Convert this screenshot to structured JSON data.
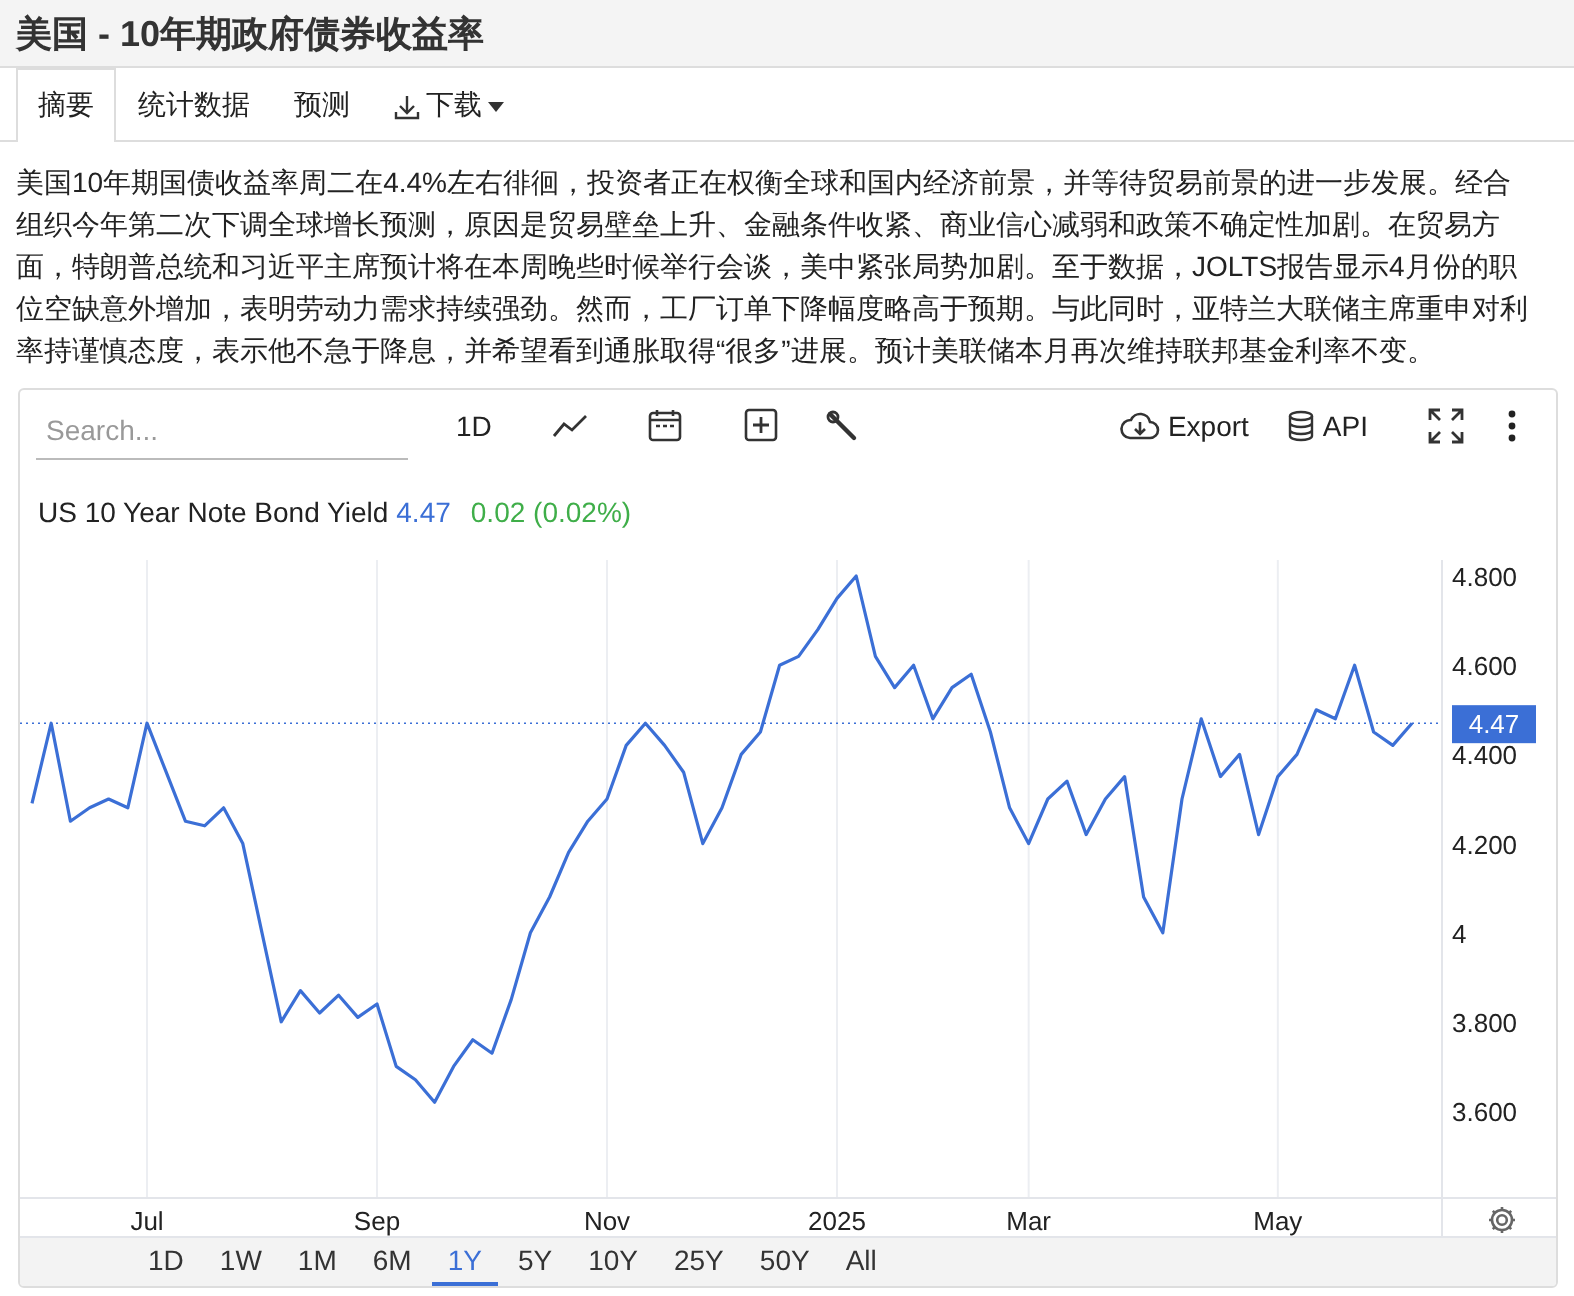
{
  "header": {
    "title": "美国 - 10年期政府债券收益率"
  },
  "tabs": [
    {
      "label": "摘要",
      "selected": true,
      "kind": "plain"
    },
    {
      "label": "统计数据",
      "selected": false,
      "kind": "plain"
    },
    {
      "label": "预测",
      "selected": false,
      "kind": "plain"
    },
    {
      "label": "下载",
      "selected": false,
      "kind": "download"
    }
  ],
  "summary": "美国10年期国债收益率周二在4.4%左右徘徊，投资者正在权衡全球和国内经济前景，并等待贸易前景的进一步发展。经合组织今年第二次下调全球增长预测，原因是贸易壁垒上升、金融条件收紧、商业信心减弱和政策不确定性加剧。在贸易方面，特朗普总统和习近平主席预计将在本周晚些时候举行会谈，美中紧张局势加剧。至于数据，JOLTS报告显示4月份的职位空缺意外增加，表明劳动力需求持续强劲。然而，工厂订单下降幅度略高于预期。与此同时，亚特兰大联储主席重申对利率持谨慎态度，表示他不急于降息，并希望看到通胀取得“很多”进展。预计美联储本月再次维持联邦基金利率不变。",
  "chart": {
    "search": {
      "placeholder": "Search..."
    },
    "interval": "1D",
    "export": "Export",
    "api": "API",
    "legend": {
      "value": "4.47",
      "change": "0.02 (0.02%)"
    },
    "last_label": "4.47",
    "chart_data": {
      "type": "line",
      "categories": [
        null,
        null,
        null,
        null,
        null,
        null,
        "Jul",
        null,
        null,
        null,
        null,
        null,
        null,
        null,
        null,
        null,
        null,
        null,
        "Sep",
        null,
        null,
        null,
        null,
        null,
        null,
        null,
        null,
        null,
        null,
        null,
        "Nov",
        null,
        null,
        null,
        null,
        null,
        null,
        null,
        null,
        null,
        null,
        null,
        "2025",
        null,
        null,
        null,
        null,
        null,
        null,
        null,
        null,
        null,
        "Mar",
        null,
        null,
        null,
        null,
        null,
        null,
        null,
        null,
        null,
        null,
        null,
        null,
        "May",
        null,
        null,
        null,
        null,
        null,
        null,
        null
      ],
      "series": [
        {
          "name": "US 10 Year Note Bond Yield",
          "color": "#3b6fd6",
          "values": [
            4.29,
            4.47,
            4.25,
            4.28,
            4.3,
            4.28,
            4.47,
            4.36,
            4.25,
            4.24,
            4.28,
            4.2,
            4.0,
            3.8,
            3.87,
            3.82,
            3.86,
            3.81,
            3.84,
            3.7,
            3.67,
            3.62,
            3.7,
            3.76,
            3.73,
            3.85,
            4.0,
            4.08,
            4.18,
            4.25,
            4.3,
            4.42,
            4.47,
            4.42,
            4.36,
            4.2,
            4.28,
            4.4,
            4.45,
            4.6,
            4.62,
            4.68,
            4.75,
            4.8,
            4.62,
            4.55,
            4.6,
            4.48,
            4.55,
            4.58,
            4.45,
            4.28,
            4.2,
            4.3,
            4.34,
            4.22,
            4.3,
            4.35,
            4.08,
            4.0,
            4.3,
            4.48,
            4.35,
            4.4,
            4.22,
            4.35,
            4.4,
            4.5,
            4.48,
            4.6,
            4.45,
            4.42,
            4.47
          ]
        }
      ],
      "ylim": [
        3.405,
        4.836
      ],
      "grid": true,
      "ref_lines": [
        {
          "axis": "y",
          "value": 4.47,
          "color": "#3b6fd6"
        }
      ],
      "yticks": [
        {
          "value": 4.8,
          "label": "4.800"
        },
        {
          "value": 4.6,
          "label": "4.600"
        },
        {
          "value": 4.4,
          "label": "4.400"
        },
        {
          "value": 4.2,
          "label": "4.200"
        },
        {
          "value": 4,
          "label": "4"
        },
        {
          "value": 3.8,
          "label": "3.800"
        },
        {
          "value": 3.6,
          "label": "3.600"
        }
      ]
    },
    "ranges": [
      {
        "label": "1D",
        "selected": false
      },
      {
        "label": "1W",
        "selected": false
      },
      {
        "label": "1M",
        "selected": false
      },
      {
        "label": "6M",
        "selected": false
      },
      {
        "label": "1Y",
        "selected": true
      },
      {
        "label": "5Y",
        "selected": false
      },
      {
        "label": "10Y",
        "selected": false
      },
      {
        "label": "25Y",
        "selected": false
      },
      {
        "label": "50Y",
        "selected": false
      },
      {
        "label": "All",
        "selected": false
      }
    ]
  }
}
